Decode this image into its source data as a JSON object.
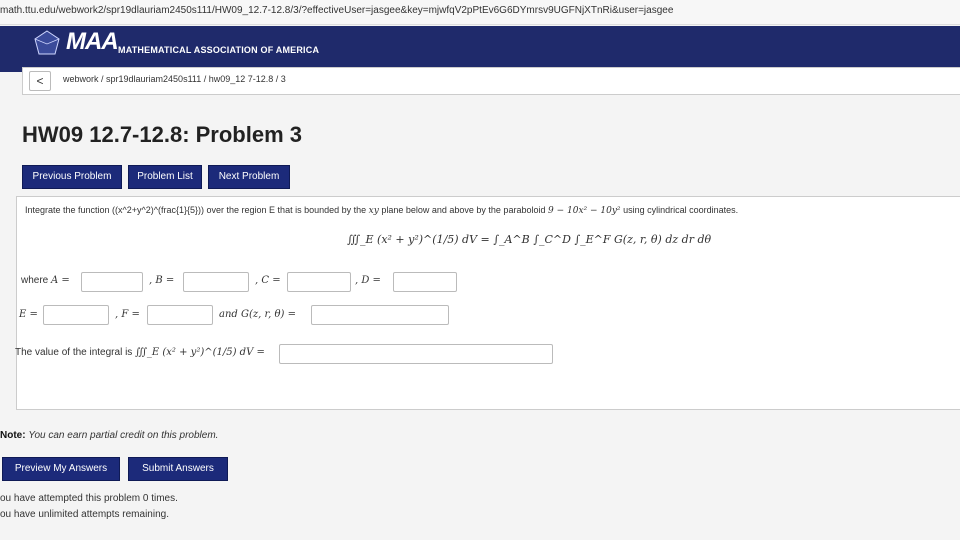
{
  "browser": {
    "url": "math.ttu.edu/webwork2/spr19dlauriam2450s111/HW09_12.7-12.8/3/?effectiveUser=jasgee&key=mjwfqV2pPtEv6G6DYmrsv9UGFNjXTnRi&user=jasgee"
  },
  "banner": {
    "logo_text": "MAA",
    "logo_subtitle": "MATHEMATICAL ASSOCIATION OF AMERICA"
  },
  "breadcrumb": {
    "back_label": "<",
    "path": "webwork / spr19dlauriam2450s111 / hw09_12 7-12.8 / 3"
  },
  "page": {
    "title": "HW09 12.7-12.8: Problem 3"
  },
  "nav": {
    "previous": "Previous Problem",
    "list": "Problem List",
    "next": "Next Problem"
  },
  "problem": {
    "statement_start": "Integrate the function ((x^2+y^2)^(frac{1}{5})) over the region E that is bounded by the",
    "plane_var": "xy",
    "statement_mid": "plane below and above by the paraboloid",
    "paraboloid": "9 − 10x² − 10y²",
    "statement_end": "using cylindrical coordinates.",
    "equation": "∭_E (x² + y²)^(1/5) dV = ∫_A^B ∫_C^D ∫_E^F G(z, r, θ) dz dr dθ",
    "labels": {
      "where": "where",
      "A": "A =",
      "B": ", B =",
      "C": ", C =",
      "D": ", D =",
      "E": "E =",
      "F": ", F =",
      "G": "and G(z, r, θ) =",
      "value": "The value of the integral is",
      "value_expr": "∭_E (x² + y²)^(1/5) dV ="
    }
  },
  "note": {
    "label": "Note:",
    "text": "You can earn partial credit on this problem."
  },
  "actions": {
    "preview": "Preview My Answers",
    "submit": "Submit Answers"
  },
  "status": {
    "attempted": "ou have attempted this problem 0 times.",
    "remaining": "ou have unlimited attempts remaining."
  }
}
